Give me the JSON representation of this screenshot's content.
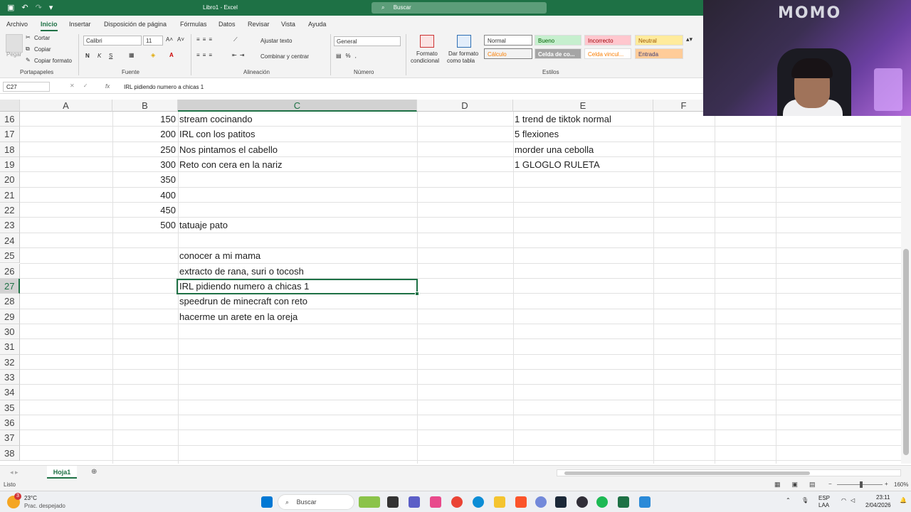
{
  "window": {
    "title": "Libro1 - Excel",
    "search_placeholder": "Buscar"
  },
  "menu": [
    "Archivo",
    "Inicio",
    "Insertar",
    "Disposición de página",
    "Fórmulas",
    "Datos",
    "Revisar",
    "Vista",
    "Ayuda"
  ],
  "ribbon": {
    "clipboard": {
      "paste": "Pegar",
      "cut": "Cortar",
      "copy": "Copiar",
      "format_painter": "Copiar formato",
      "label": "Portapapeles"
    },
    "font": {
      "name": "Calibri",
      "size": "11",
      "label": "Fuente",
      "bold": "N",
      "italic": "K",
      "underline": "S"
    },
    "alignment": {
      "wrap": "Ajustar texto",
      "merge": "Combinar y centrar",
      "label": "Alineación"
    },
    "number": {
      "format": "General",
      "label": "Número"
    },
    "styles": {
      "conditional": [
        "Formato",
        "condicional"
      ],
      "table": [
        "Dar formato",
        "como tabla"
      ],
      "cells": [
        "Normal",
        "Bueno",
        "Incorrecto",
        "Neutral",
        "Cálculo",
        "Celda de co...",
        "Celda vincul...",
        "Entrada"
      ],
      "label": "Estilos"
    }
  },
  "formula_bar": {
    "name_box": "C27",
    "fx": "fx",
    "content": "IRL pidiendo numero a chicas 1"
  },
  "columns": [
    "A",
    "B",
    "C",
    "D",
    "E",
    "F"
  ],
  "rows": [
    {
      "n": "16",
      "b": "150",
      "c": "stream cocinando",
      "e": "1 trend de tiktok normal"
    },
    {
      "n": "17",
      "b": "200",
      "c": "IRL con los patitos",
      "e": "5 flexiones"
    },
    {
      "n": "18",
      "b": "250",
      "c": "Nos pintamos el cabello",
      "e": "morder una cebolla"
    },
    {
      "n": "19",
      "b": "300",
      "c": "Reto con cera en la nariz",
      "e": "1 GLOGLO RULETA"
    },
    {
      "n": "20",
      "b": "350",
      "c": "",
      "e": ""
    },
    {
      "n": "21",
      "b": "400",
      "c": "",
      "e": ""
    },
    {
      "n": "22",
      "b": "450",
      "c": "",
      "e": ""
    },
    {
      "n": "23",
      "b": "500",
      "c": "tatuaje pato",
      "e": ""
    },
    {
      "n": "24",
      "b": "",
      "c": "",
      "e": ""
    },
    {
      "n": "25",
      "b": "",
      "c": "conocer a mi mama",
      "e": ""
    },
    {
      "n": "26",
      "b": "",
      "c": "extracto de rana, suri o tocosh",
      "e": ""
    },
    {
      "n": "27",
      "b": "",
      "c": "IRL pidiendo numero a chicas 1",
      "e": ""
    },
    {
      "n": "28",
      "b": "",
      "c": "speedrun de minecraft con reto",
      "e": ""
    },
    {
      "n": "29",
      "b": "",
      "c": "hacerme un arete en la oreja",
      "e": ""
    },
    {
      "n": "30",
      "b": "",
      "c": "",
      "e": ""
    },
    {
      "n": "31",
      "b": "",
      "c": "",
      "e": ""
    },
    {
      "n": "32",
      "b": "",
      "c": "",
      "e": ""
    },
    {
      "n": "33",
      "b": "",
      "c": "",
      "e": ""
    },
    {
      "n": "34",
      "b": "",
      "c": "",
      "e": ""
    },
    {
      "n": "35",
      "b": "",
      "c": "",
      "e": ""
    },
    {
      "n": "36",
      "b": "",
      "c": "",
      "e": ""
    },
    {
      "n": "37",
      "b": "",
      "c": "",
      "e": ""
    },
    {
      "n": "38",
      "b": "",
      "c": "",
      "e": ""
    }
  ],
  "active_cell": "C27",
  "sheet_tab": "Hoja1",
  "status": {
    "ready": "Listo",
    "zoom": "160%"
  },
  "taskbar": {
    "weather_temp": "23°C",
    "weather_desc": "Prac. despejado",
    "weather_badge": "3",
    "search": "Buscar",
    "lang": "ESP",
    "lang2": "LAA",
    "time": "23:11",
    "date": "2/04/2026"
  },
  "webcam": {
    "sign": "MOMO"
  },
  "colors": {
    "accent": "#1e7145",
    "title_bar": "#1e7145"
  }
}
